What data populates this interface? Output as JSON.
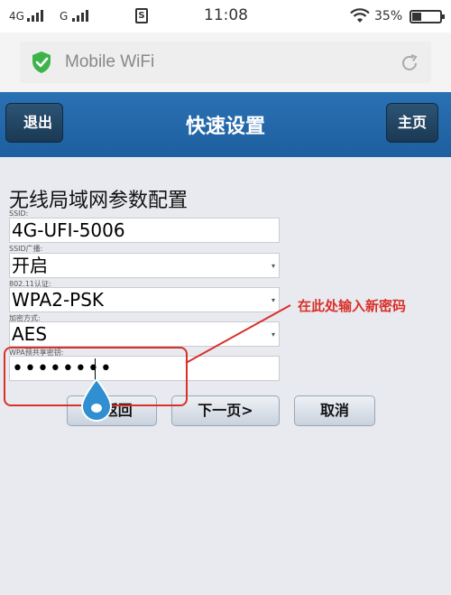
{
  "status_bar": {
    "signal1_label": "4G",
    "signal2_label": "G",
    "sim_icon": "S",
    "time": "11:08",
    "battery": "35%"
  },
  "browser": {
    "title": "Mobile WiFi",
    "secure_icon": "shield-check-icon",
    "reload_icon": "reload-icon"
  },
  "header": {
    "back_label": "退出",
    "title": "快速设置",
    "home_label": "主页",
    "color": "#2a71b3"
  },
  "form": {
    "section_title": "无线局域网参数配置",
    "ssid_label": "SSID:",
    "ssid_value": "4G-UFI-5006",
    "broadcast_label": "SSID广播:",
    "broadcast_value": "开启",
    "auth_label": "802.11认证:",
    "auth_value": "WPA2-PSK",
    "encryption_label": "加密方式:",
    "encryption_value": "AES",
    "psk_label": "WPA预共享密钥:",
    "psk_value": "••••••••"
  },
  "buttons": {
    "prev_label": "<返回",
    "next_label": "下一页>",
    "cancel_label": "取消"
  },
  "annotation": {
    "text": "在此处输入新密码",
    "color": "#d9302a"
  }
}
